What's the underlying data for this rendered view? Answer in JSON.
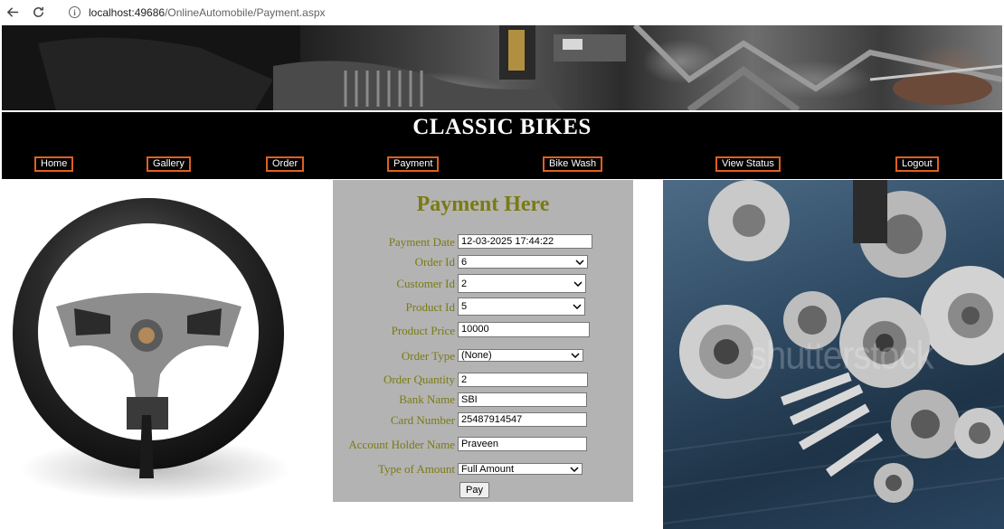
{
  "browser": {
    "url_host": "localhost:49686",
    "url_path": "/OnlineAutomobile/Payment.aspx"
  },
  "site": {
    "title": "CLASSIC BIKES"
  },
  "nav": [
    {
      "label": "Home"
    },
    {
      "label": "Gallery"
    },
    {
      "label": "Order"
    },
    {
      "label": "Payment"
    },
    {
      "label": "Bike Wash"
    },
    {
      "label": "View Status"
    },
    {
      "label": "Logout"
    }
  ],
  "form": {
    "title": "Payment Here",
    "payment_date": {
      "label": "Payment Date",
      "value": "12-03-2025 17:44:22"
    },
    "order_id": {
      "label": "Order Id",
      "value": "6"
    },
    "customer_id": {
      "label": "Customer Id",
      "value": "2"
    },
    "product_id": {
      "label": "Product Id",
      "value": "5"
    },
    "product_price": {
      "label": "Product Price",
      "value": "10000"
    },
    "order_type": {
      "label": "Order Type",
      "value": "(None)"
    },
    "order_quantity": {
      "label": "Order Quantity",
      "value": "2"
    },
    "bank_name": {
      "label": "Bank Name",
      "value": "SBI"
    },
    "card_number": {
      "label": "Card Number",
      "value": "25487914547"
    },
    "account_holder": {
      "label": "Account Holder Name",
      "value": "Praveen"
    },
    "type_of_amount": {
      "label": "Type of Amount",
      "value": "Full Amount"
    },
    "pay_label": "Pay"
  },
  "images": {
    "watermark": "shutterstock"
  },
  "icons": {
    "back": "back-arrow-icon",
    "reload": "reload-icon",
    "info": "info-icon",
    "dropdown": "chevron-down-icon"
  },
  "colors": {
    "header_bg": "#000000",
    "nav_border": "#e0601e",
    "form_bg": "#b3b3b3",
    "form_text": "#7a7a14"
  }
}
